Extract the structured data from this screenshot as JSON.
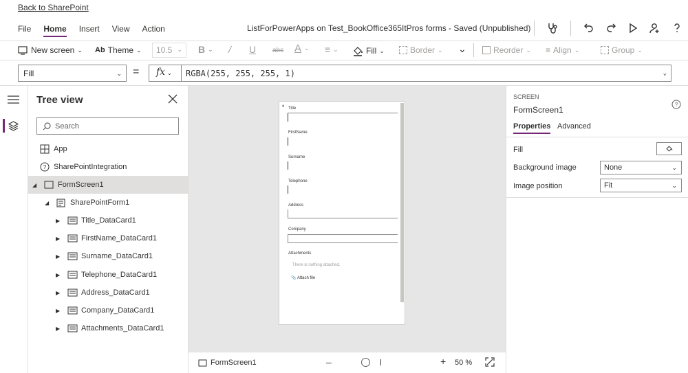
{
  "back_link": "Back to SharePoint",
  "menu": [
    {
      "label": "File",
      "active": false
    },
    {
      "label": "Home",
      "active": true
    },
    {
      "label": "Insert",
      "active": false
    },
    {
      "label": "View",
      "active": false
    },
    {
      "label": "Action",
      "active": false
    }
  ],
  "doc_title": "ListForPowerApps on Test_BookOffice365ItPros forms - Saved (Unpublished)",
  "ribbon": {
    "new_screen": "New screen",
    "theme": "Theme",
    "font_size": "10.5",
    "fill": "Fill",
    "border": "Border",
    "reorder": "Reorder",
    "align": "Align",
    "group": "Group"
  },
  "formula": {
    "property": "Fill",
    "equals": "=",
    "fx": "fx",
    "value": "RGBA(255, 255, 255, 1)"
  },
  "tree": {
    "title": "Tree view",
    "search_placeholder": "Search",
    "items": [
      {
        "label": "App"
      },
      {
        "label": "SharePointIntegration"
      },
      {
        "label": "FormScreen1"
      },
      {
        "label": "SharePointForm1"
      },
      {
        "label": "Title_DataCard1"
      },
      {
        "label": "FirstName_DataCard1"
      },
      {
        "label": "Surname_DataCard1"
      },
      {
        "label": "Telephone_DataCard1"
      },
      {
        "label": "Address_DataCard1"
      },
      {
        "label": "Company_DataCard1"
      },
      {
        "label": "Attachments_DataCard1"
      }
    ]
  },
  "form": {
    "fields": [
      "Title",
      "FirstName",
      "Surname",
      "Telephone",
      "Address",
      "Company"
    ],
    "attachments_label": "Attachments",
    "attachments_empty": "There is nothing attached.",
    "attach_file": "Attach file"
  },
  "status": {
    "screen_name": "FormScreen1",
    "zoom": "50",
    "zoom_unit": "%",
    "zoom_level": 0.5
  },
  "properties": {
    "kind": "SCREEN",
    "name": "FormScreen1",
    "tab_properties": "Properties",
    "tab_advanced": "Advanced",
    "fill_label": "Fill",
    "bg_image_label": "Background image",
    "bg_image_value": "None",
    "img_pos_label": "Image position",
    "img_pos_value": "Fit"
  },
  "colors": {
    "accent": "#742774",
    "canvas_bg": "#e6e6e6",
    "selected_row": "#e1dfdd"
  }
}
